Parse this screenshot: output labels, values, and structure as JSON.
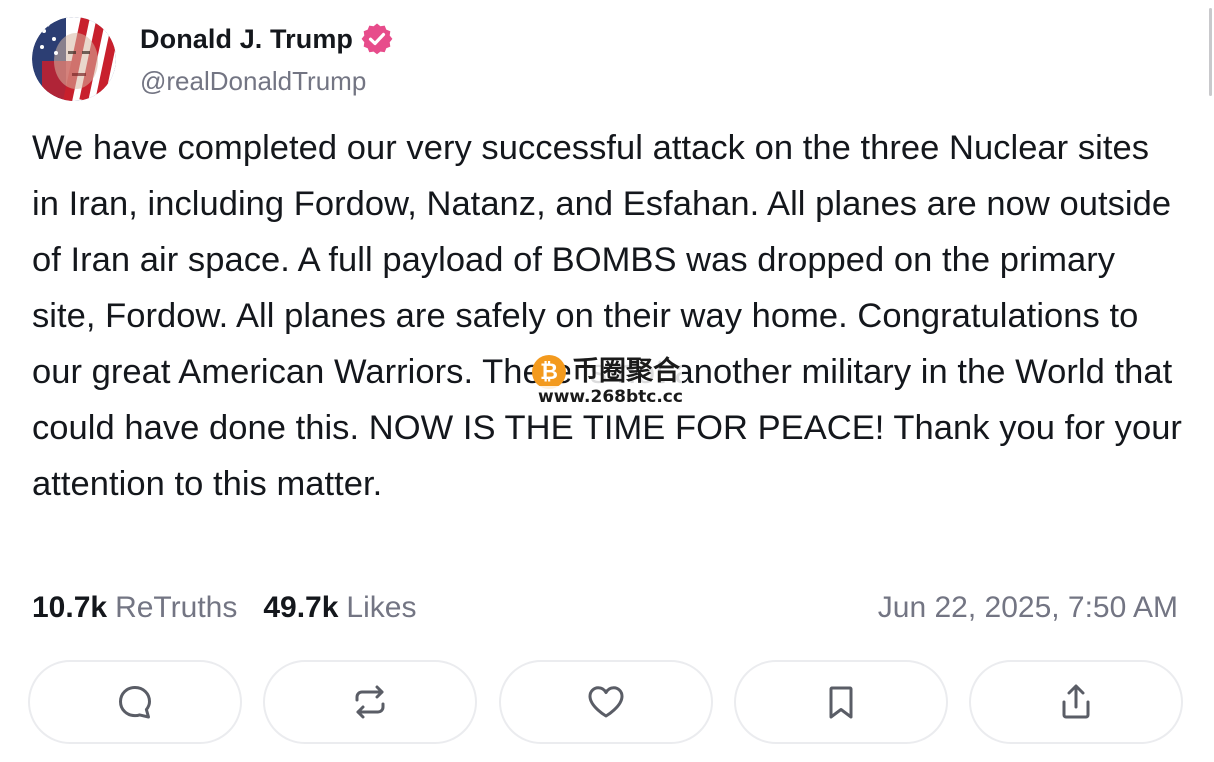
{
  "author": {
    "display_name": "Donald J. Trump",
    "handle": "@realDonaldTrump",
    "verified": true,
    "verified_color": "#e74c8b"
  },
  "post": {
    "text": "We have completed our very successful attack on the three Nuclear sites in Iran, including Fordow, Natanz, and Esfahan. All planes are now outside of Iran air space. A full payload of BOMBS was dropped on the primary site, Fordow. All planes are safely on their way home. Congratulations to our great American Warriors. There is not another military in the World that could have done this. NOW IS THE TIME FOR PEACE! Thank you for your attention to this matter."
  },
  "stats": {
    "retruths_count": "10.7k",
    "retruths_label": "ReTruths",
    "likes_count": "49.7k",
    "likes_label": "Likes",
    "timestamp": "Jun 22, 2025, 7:50 AM"
  },
  "actions": [
    {
      "name": "reply",
      "icon": "speech-bubble-icon"
    },
    {
      "name": "retruth",
      "icon": "repost-arrows-icon"
    },
    {
      "name": "like",
      "icon": "heart-icon"
    },
    {
      "name": "bookmark",
      "icon": "bookmark-icon"
    },
    {
      "name": "share",
      "icon": "share-upload-icon"
    }
  ],
  "watermark": {
    "logo_glyph": "₿",
    "site_name": "币圈聚合",
    "url": "www.268btc.cc",
    "logo_color": "#f39a1e"
  },
  "colors": {
    "text_primary": "#14171c",
    "text_secondary": "#737583",
    "button_border": "#ebecef",
    "icon_stroke": "#5a5d66"
  }
}
